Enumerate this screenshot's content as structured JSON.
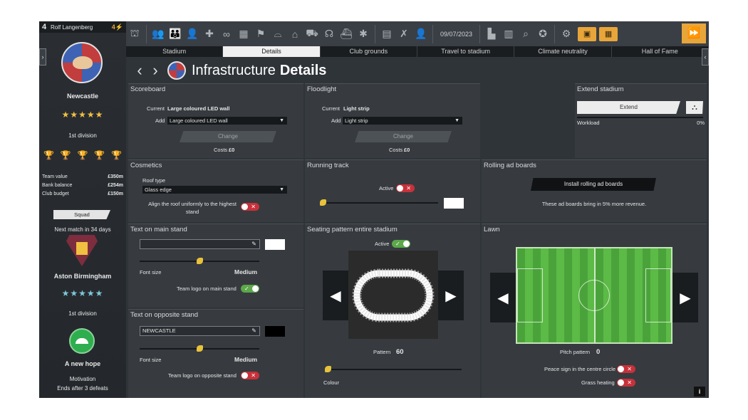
{
  "sidebar": {
    "rank": "4",
    "manager": "Rolf Langenberg",
    "level": "4",
    "club": "Newcastle",
    "club_stars": "★★★★★",
    "club_division": "1st division",
    "finances": [
      {
        "label": "Team value",
        "value": "£350m"
      },
      {
        "label": "Bank balance",
        "value": "£254m"
      },
      {
        "label": "Club budget",
        "value": "£150m"
      }
    ],
    "squad_label": "Squad",
    "next_match": "Next match in 34 days",
    "opponent": "Aston Birmingham",
    "opponent_stars": "★★★★★",
    "opponent_division": "1st division",
    "motivation_title": "A new hope",
    "motivation_label": "Motivation",
    "motivation_detail": "Ends after 3 defeats"
  },
  "toolbar": {
    "date": "09/07/2023"
  },
  "tabs": [
    "Stadium",
    "Details",
    "Club grounds",
    "Travel to stadium",
    "Climate neutrality",
    "Hall of Fame"
  ],
  "header": {
    "title": "Infrastructure",
    "subtitle": "Details"
  },
  "scoreboard": {
    "title": "Scoreboard",
    "current_label": "Current",
    "current_value": "Large coloured LED wall",
    "add_label": "Add",
    "add_value": "Large coloured LED wall",
    "change_label": "Change",
    "costs_label": "Costs",
    "costs_value": "£0"
  },
  "floodlight": {
    "title": "Floodlight",
    "current_label": "Current",
    "current_value": "Light strip",
    "add_label": "Add",
    "add_value": "Light strip",
    "change_label": "Change",
    "costs_label": "Costs",
    "costs_value": "£0"
  },
  "extend": {
    "title": "Extend stadium",
    "button": "Extend",
    "workload_label": "Workload",
    "workload_value": "0%"
  },
  "cosmetics": {
    "title": "Cosmetics",
    "roof_label": "Roof type",
    "roof_value": "Glass edge",
    "align_label": "Align the roof uniformly to the highest stand"
  },
  "running_track": {
    "title": "Running track",
    "active_label": "Active"
  },
  "ad_boards": {
    "title": "Rolling ad boards",
    "button": "Install rolling ad boards",
    "note": "These ad boards bring in 5% more revenue."
  },
  "main_stand": {
    "title": "Text on main stand",
    "text_value": "",
    "font_size_label": "Font size",
    "font_size_value": "Medium",
    "logo_label": "Team logo on main stand"
  },
  "opposite_stand": {
    "title": "Text on opposite stand",
    "text_value": "NEWCASTLE",
    "font_size_label": "Font size",
    "font_size_value": "Medium",
    "logo_label": "Team logo on opposite stand"
  },
  "seating": {
    "title": "Seating pattern entire stadium",
    "active_label": "Active",
    "pattern_label": "Pattern",
    "pattern_value": "60",
    "colour_label": "Colour"
  },
  "lawn": {
    "title": "Lawn",
    "pattern_label": "Pitch pattern",
    "pattern_value": "0",
    "peace_label": "Peace sign in the centre circle",
    "heating_label": "Grass heating"
  },
  "colors": {
    "accent": "#e8a53a",
    "toggle_off": "#c8313a",
    "toggle_on": "#5ca84a"
  }
}
